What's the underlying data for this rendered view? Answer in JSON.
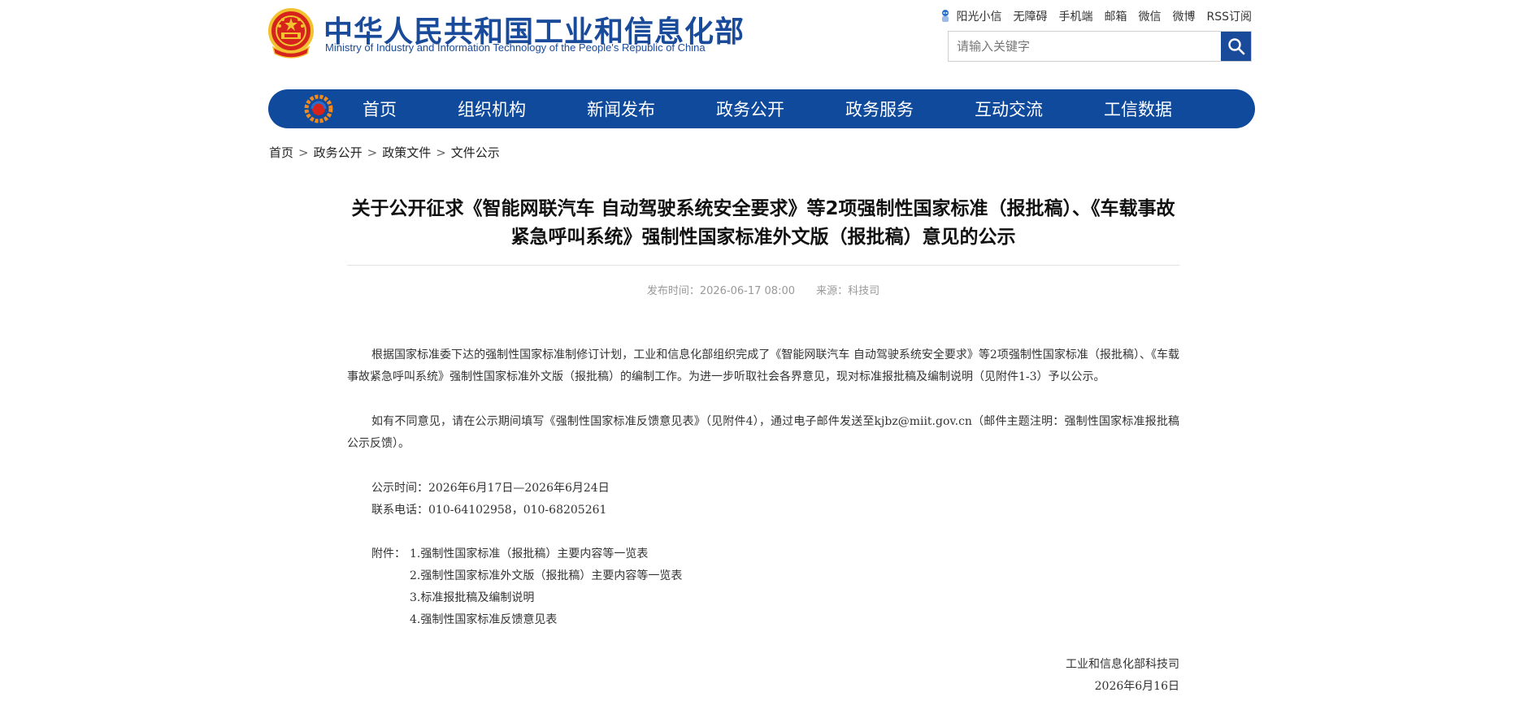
{
  "header": {
    "site_name_cn": "中华人民共和国工业和信息化部",
    "site_name_en": "Ministry of Industry and Information Technology of the People's Republic of China",
    "top_links": [
      "阳光小信",
      "无障碍",
      "手机端",
      "邮箱",
      "微信",
      "微博",
      "RSS订阅"
    ],
    "search_placeholder": "请输入关键字"
  },
  "nav": {
    "items": [
      "首页",
      "组织机构",
      "新闻发布",
      "政务公开",
      "政务服务",
      "互动交流",
      "工信数据"
    ]
  },
  "breadcrumb": [
    "首页",
    "政务公开",
    "政策文件",
    "文件公示"
  ],
  "article": {
    "title": "关于公开征求《智能网联汽车 自动驾驶系统安全要求》等2项强制性国家标准（报批稿）、《车载事故紧急呼叫系统》强制性国家标准外文版（报批稿）意见的公示",
    "publish_time": "发布时间：2026-06-17 08:00",
    "source": "来源：科技司",
    "paragraph_1": "根据国家标准委下达的强制性国家标准制修订计划，工业和信息化部组织完成了《智能网联汽车 自动驾驶系统安全要求》等2项强制性国家标准（报批稿）、《车载事故紧急呼叫系统》强制性国家标准外文版（报批稿）的编制工作。为进一步听取社会各界意见，现对标准报批稿及编制说明（见附件1-3）予以公示。",
    "paragraph_2": "如有不同意见，请在公示期间填写《强制性国家标准反馈意见表》（见附件4），通过电子邮件发送至kjbz@miit.gov.cn（邮件主题注明：强制性国家标准报批稿公示反馈）。",
    "notice_period": "公示时间：2026年6月17日—2026年6月24日",
    "contact_phone": "联系电话：010-64102958，010-68205261",
    "attachments_label": "附件：",
    "attachments": [
      "1.强制性国家标准（报批稿）主要内容等一览表",
      "2.强制性国家标准外文版（报批稿）主要内容等一览表",
      "3.标准报批稿及编制说明",
      "4.强制性国家标准反馈意见表"
    ],
    "signature_org": "工业和信息化部科技司",
    "signature_date": "2026年6月16日"
  },
  "colors": {
    "brand_blue": "#0f4a9c",
    "title_blue": "#1a4a9a",
    "emblem_red": "#d6231c",
    "emblem_gold": "#f2c230"
  },
  "icons": [
    "national-emblem-icon",
    "robot-assistant-icon",
    "search-icon",
    "nav-logo-icon"
  ]
}
